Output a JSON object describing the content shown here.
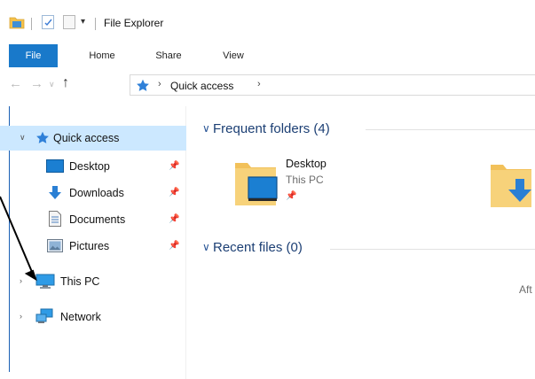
{
  "window": {
    "title": "File Explorer",
    "qa_dropdown": "▾"
  },
  "ribbon": {
    "tabs": [
      {
        "label": "File"
      },
      {
        "label": "Home"
      },
      {
        "label": "Share"
      },
      {
        "label": "View"
      }
    ]
  },
  "address_bar": {
    "path": "Quick access"
  },
  "nav_pane": {
    "quick_access": {
      "label": "Quick access"
    },
    "items": [
      {
        "label": "Desktop",
        "icon": "desktop-icon"
      },
      {
        "label": "Downloads",
        "icon": "downloads-icon"
      },
      {
        "label": "Documents",
        "icon": "documents-icon"
      },
      {
        "label": "Pictures",
        "icon": "pictures-icon"
      }
    ],
    "this_pc": {
      "label": "This PC"
    },
    "network": {
      "label": "Network"
    }
  },
  "content": {
    "frequent_folders": {
      "header": "Frequent folders (4)",
      "items": [
        {
          "name": "Desktop",
          "location": "This PC"
        }
      ]
    },
    "recent_files": {
      "header": "Recent files (0)",
      "empty_text": "Aft"
    }
  },
  "colors": {
    "accent": "#1979ca",
    "selection": "#cce8ff",
    "header_blue": "#1c3f74"
  }
}
